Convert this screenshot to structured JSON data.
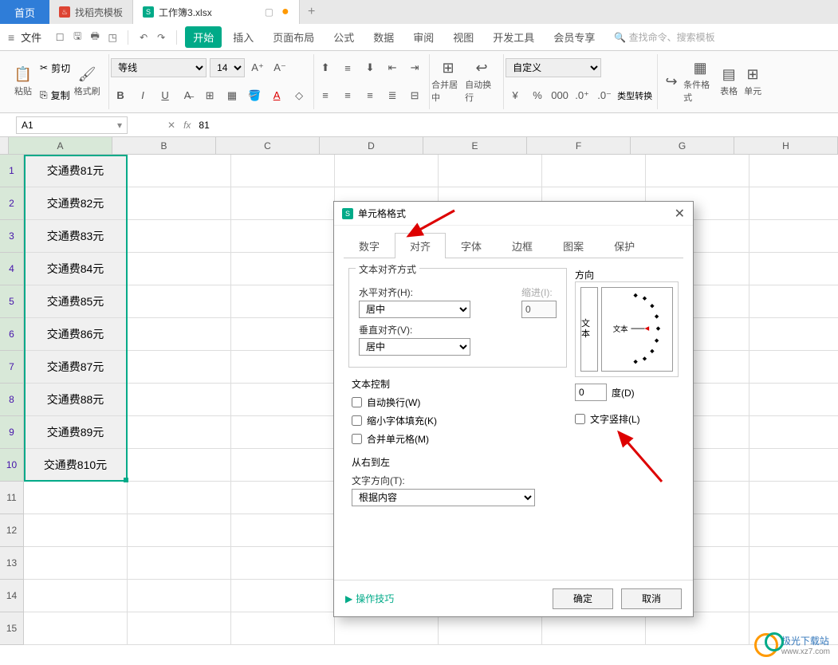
{
  "tabs": {
    "home": "首页",
    "template": "找稻壳模板",
    "workbook": "工作簿3.xlsx",
    "plus": "+"
  },
  "menu": {
    "file": "文件",
    "tabs": [
      "开始",
      "插入",
      "页面布局",
      "公式",
      "数据",
      "审阅",
      "视图",
      "开发工具",
      "会员专享"
    ],
    "search_placeholder": "查找命令、搜索模板"
  },
  "ribbon": {
    "paste": "粘贴",
    "cut": "剪切",
    "copy": "复制",
    "format_painter": "格式刷",
    "font_name": "等线",
    "font_size": "14",
    "merge": "合并居中",
    "wrap": "自动换行",
    "num_format": "自定义",
    "type_convert": "类型转换",
    "cond_format": "条件格式",
    "cell_format": "单元",
    "tables": "表格"
  },
  "namebox": "A1",
  "fx_value": "81",
  "rows": [
    "1",
    "2",
    "3",
    "4",
    "5",
    "6",
    "7",
    "8",
    "9",
    "10",
    "11",
    "12",
    "13",
    "14",
    "15"
  ],
  "cols": [
    "A",
    "B",
    "C",
    "D",
    "E",
    "F",
    "G",
    "H"
  ],
  "data": [
    "交通费81元",
    "交通费82元",
    "交通费83元",
    "交通费84元",
    "交通费85元",
    "交通费86元",
    "交通费87元",
    "交通费88元",
    "交通费89元",
    "交通费810元"
  ],
  "dialog": {
    "title": "单元格格式",
    "tabs": [
      "数字",
      "对齐",
      "字体",
      "边框",
      "图案",
      "保护"
    ],
    "group_align": "文本对齐方式",
    "h_align_label": "水平对齐(H):",
    "h_align_value": "居中",
    "indent_label": "缩进(I):",
    "indent_value": "0",
    "v_align_label": "垂直对齐(V):",
    "v_align_value": "居中",
    "group_control": "文本控制",
    "wrap_check": "自动换行(W)",
    "shrink_check": "缩小字体填充(K)",
    "merge_check": "合并单元格(M)",
    "group_rtl": "从右到左",
    "text_dir_label": "文字方向(T):",
    "text_dir_value": "根据内容",
    "group_orient": "方向",
    "orient_vert": "文本",
    "orient_center": "文本",
    "degree_value": "0",
    "degree_label": "度(D)",
    "vert_text_check": "文字竖排(L)",
    "tips": "操作技巧",
    "ok": "确定",
    "cancel": "取消"
  },
  "watermark": {
    "name": "极光下载站",
    "url": "www.xz7.com"
  }
}
